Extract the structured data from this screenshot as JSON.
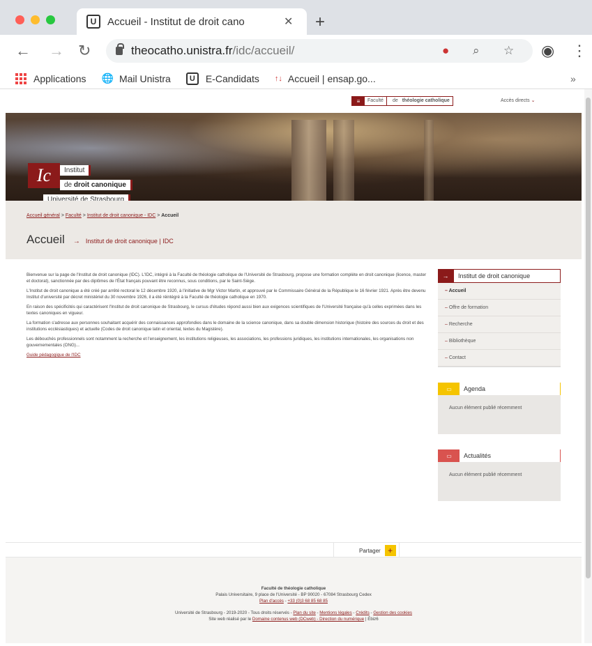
{
  "browser": {
    "tab_title": "Accueil - Institut de droit cano",
    "favicon_letter": "U",
    "url_host": "theocatho.unistra.fr",
    "url_path": "/idc/accueil/",
    "bookmarks": [
      {
        "label": "Applications",
        "icon": "apps-grid-icon"
      },
      {
        "label": "Mail Unistra",
        "icon": "globe-icon"
      },
      {
        "label": "E-Candidats",
        "icon": "u-logo-icon"
      },
      {
        "label": "Accueil | ensap.go...",
        "icon": "red-logo-icon"
      }
    ],
    "more_bookmarks": "»"
  },
  "site": {
    "faculty_selector": {
      "prefix": "Faculté",
      "middle": "de",
      "bold": "théologie catholique"
    },
    "quick_access": "Accès directs",
    "logo": {
      "mark": "Ic",
      "line1": "Institut",
      "line2_pre": "de",
      "line2_bold": "droit canonique",
      "line3": "Université de Strasbourg"
    },
    "breadcrumb": {
      "home": "Accueil général",
      "faculty": "Faculté",
      "institute": "Institut de droit canonique - IDC",
      "current": "Accueil"
    },
    "page_title": "Accueil",
    "page_subtitle": "Institut de droit canonique | IDC",
    "content": {
      "paragraphs": [
        "Bienvenue sur la page de l'Institut de droit canonique (IDC). L'IDC, intégré à la Faculté de théologie catholique de l'Université de Strasbourg, propose une formation complète en droit canonique (licence, master et doctorat), sanctionnée par des diplômes de l'État français pouvant être reconnus, sous conditions, par le Saint-Siège.",
        "L'Institut de droit canonique a été créé par arrêté rectoral le 12 décembre 1920, à l'initiative de Mgr Victor Martin, et approuvé par le Commissaire Général de la République le 16 février 1921. Après être devenu Institut d'université par décret ministériel du 30 novembre 1926, il a été réintégré à la Faculté de théologie catholique en 1970.",
        "En raison des spécificités qui caractérisent l'Institut de droit canonique de Strasbourg, le cursus d'études répond aussi bien aux exigences scientifiques de l'Université française qu'à celles exprimées dans les textes canoniques en vigueur.",
        "La formation s'adresse aux personnes souhaitant acquérir des connaissances approfondies dans le domaine de la science canonique, dans sa double dimension historique (histoire des sources du droit et des institutions ecclésiastiques) et actuelle (Codes de droit canonique latin et oriental, textes du Magistère).",
        "Les débouchés professionnels sont notamment la recherche et l'enseignement, les institutions religieuses, les associations, les professions juridiques, les institutions internationales, les organisations non gouvernementales (ONG)..."
      ],
      "link": "Guide pédagogique de l'IDC"
    },
    "sidebar": {
      "title": "Institut de droit canonique",
      "items": [
        "Accueil",
        "Offre de formation",
        "Recherche",
        "Bibliothèque",
        "Contact"
      ]
    },
    "agenda": {
      "title": "Agenda",
      "empty": "Aucun élément publié récemment"
    },
    "news": {
      "title": "Actualités",
      "empty": "Aucun élément publié récemment"
    },
    "share_label": "Partager",
    "share_plus": "+",
    "footer": {
      "name": "Faculté de théologie catholique",
      "address": "Palais Universitaire, 9 place de l'Université - BP 90020 - 67084 Strasbourg Cedex",
      "plan": "Plan d'accès",
      "phone": "+33 (0)3 68 85 68 85",
      "copyright": "Université de Strasbourg - 2019-2020 - Tous droits réservés -",
      "links": [
        "Plan du site",
        "Mentions légales",
        "Crédits",
        "Gestion des cookies"
      ],
      "made_by_pre": "Site web réalisé par le",
      "made_by_link": "Domaine contenus web (DCweb) - Direction du numérique",
      "cms": "| Ébiz6"
    }
  },
  "colors": {
    "accent": "#8b1a1a",
    "agenda": "#f5c400",
    "news": "#d9534f"
  }
}
